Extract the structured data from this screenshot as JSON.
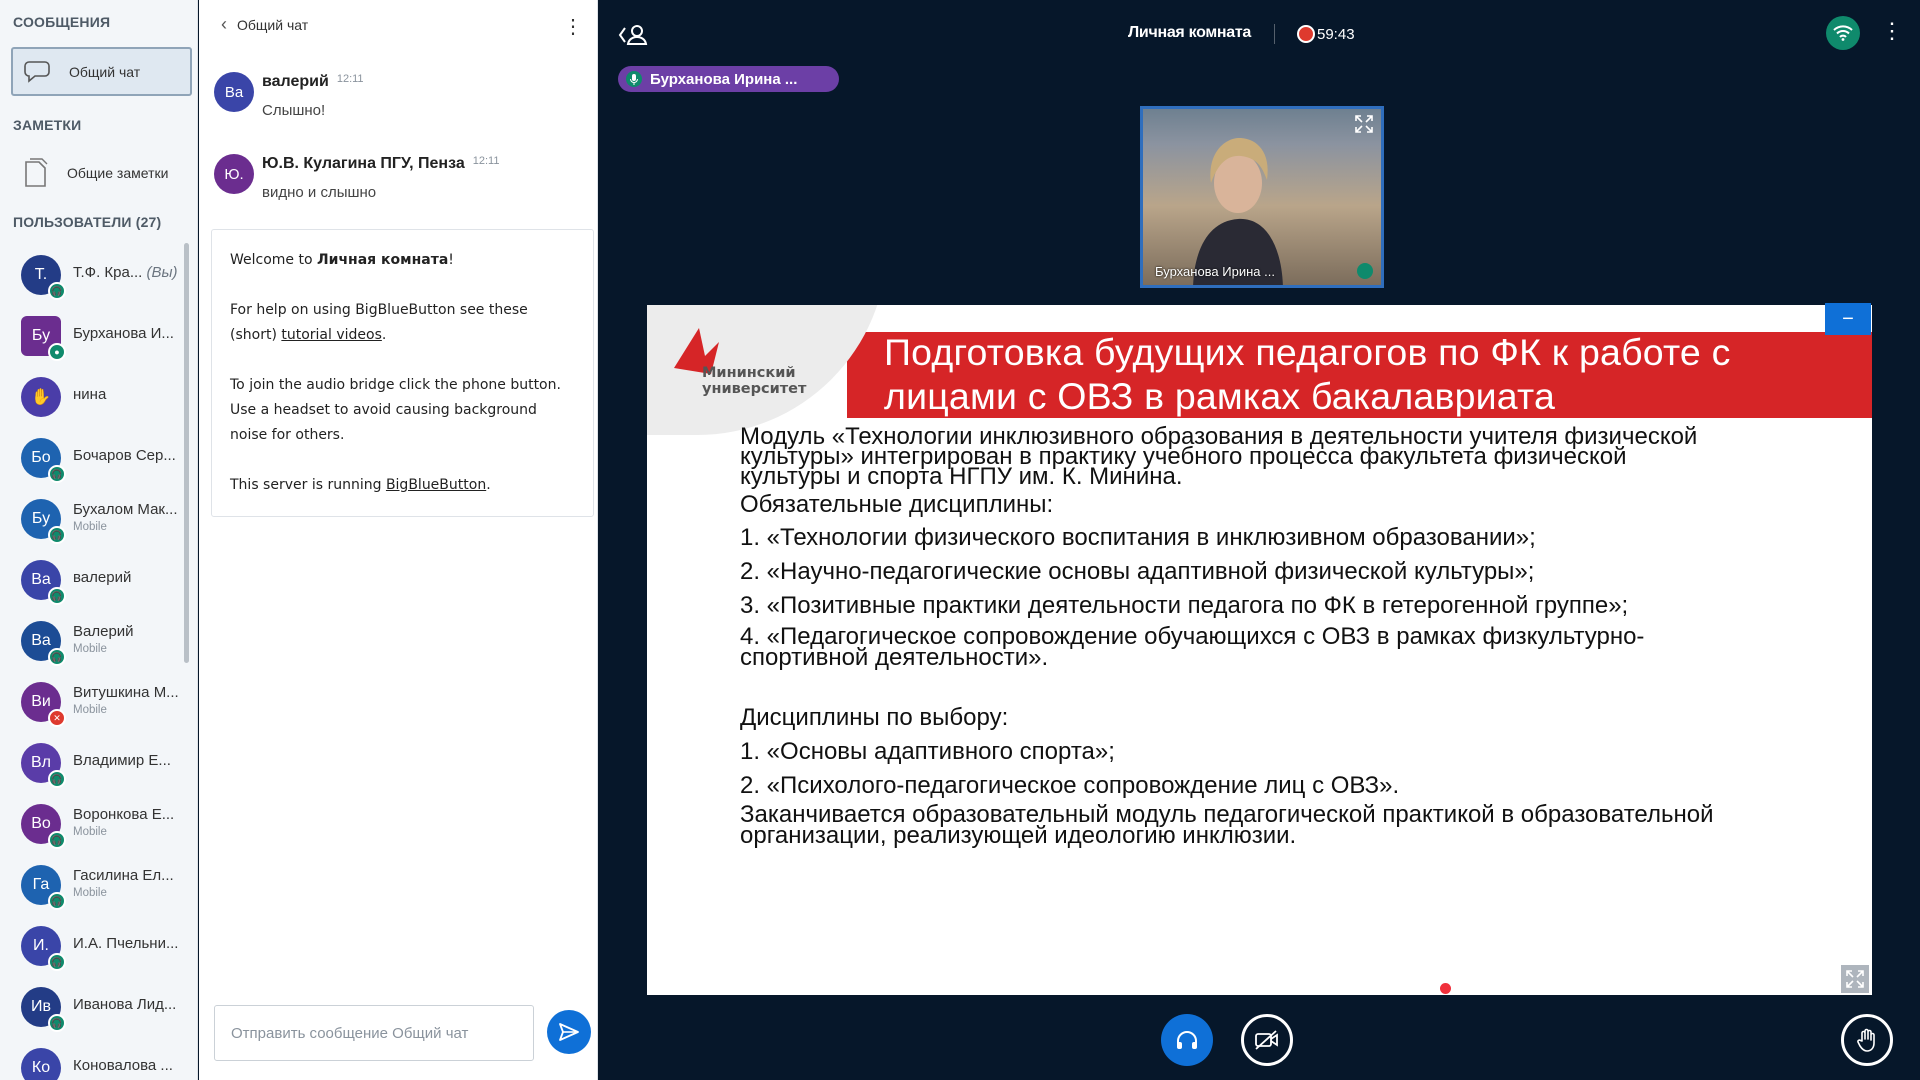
{
  "sidebar": {
    "messages_title": "СООБЩЕНИЯ",
    "public_chat": "Общий чат",
    "notes_title": "ЗАМЕТКИ",
    "shared_notes": "Общие заметки",
    "users_title": "ПОЛЬЗОВАТЕЛИ (27)"
  },
  "users": [
    {
      "initials": "Т.",
      "name": "Т.Ф. Кра...",
      "you": "(Вы)",
      "sub": "",
      "color": "#233c86",
      "badge": "headset"
    },
    {
      "initials": "Бу",
      "name": "Бурханова И...",
      "sub": "",
      "color": "#6b2d8f",
      "badge": "mic"
    },
    {
      "initials": "",
      "name": "нина",
      "sub": "",
      "color": "#4a3da8",
      "badge": "none"
    },
    {
      "initials": "Бо",
      "name": "Бочаров Сер...",
      "sub": "",
      "color": "#1e63b0",
      "badge": "headset"
    },
    {
      "initials": "Бу",
      "name": "Бухалом Мак...",
      "sub": "Mobile",
      "color": "#1e63b0",
      "badge": "headset"
    },
    {
      "initials": "Ва",
      "name": "валерий",
      "sub": "",
      "color": "#3a45a8",
      "badge": "headset"
    },
    {
      "initials": "Ва",
      "name": "Валерий",
      "sub": "Mobile",
      "color": "#1c4c95",
      "badge": "headset"
    },
    {
      "initials": "Ви",
      "name": "Витушкина М...",
      "sub": "Mobile",
      "color": "#6b2d8f",
      "badge": "muted"
    },
    {
      "initials": "Вл",
      "name": "Владимир Е...",
      "sub": "",
      "color": "#5a3ca8",
      "badge": "headset"
    },
    {
      "initials": "Во",
      "name": "Воронкова Е...",
      "sub": "Mobile",
      "color": "#6b2d8f",
      "badge": "headset"
    },
    {
      "initials": "Га",
      "name": "Гасилина Ел...",
      "sub": "Mobile",
      "color": "#1e63b0",
      "badge": "headset"
    },
    {
      "initials": "И.",
      "name": "И.А. Пчельни...",
      "sub": "",
      "color": "#3a45a8",
      "badge": "headset"
    },
    {
      "initials": "Ив",
      "name": "Иванова Лид...",
      "sub": "",
      "color": "#233c86",
      "badge": "headset"
    },
    {
      "initials": "Ко",
      "name": "Коновалова ...",
      "sub": "",
      "color": "#3a45a8",
      "badge": "none"
    }
  ],
  "chat": {
    "title": "Общий чат",
    "messages": [
      {
        "initials": "Ва",
        "name": "валерий",
        "time": "12:11",
        "text": "Слышно!",
        "color": "#3a45a8"
      },
      {
        "initials": "Ю.",
        "name": "Ю.В. Кулагина ПГУ, Пенза",
        "time": "12:11",
        "text": "видно и слышно",
        "color": "#6b2d8f"
      }
    ],
    "welcome": {
      "p1_prefix": "Welcome to ",
      "p1_room": "Личная комната",
      "p1_suffix": "!",
      "p2_text": "For help on using BigBlueButton see these (short) ",
      "p2_link": "tutorial videos",
      "p2_end": ".",
      "p3": "To join the audio bridge click the phone button. Use a headset to avoid causing background noise for others.",
      "p4_text": "This server is running ",
      "p4_link": "BigBlueButton",
      "p4_end": "."
    },
    "input_placeholder": "Отправить сообщение Общий чат"
  },
  "main": {
    "room_title": "Личная комната",
    "rec_time": "59:43",
    "talker": "Бурханова Ирина ...",
    "video_name": "Бурханова Ирина ..."
  },
  "slide": {
    "logo_line1": "Мининский",
    "logo_line2": "университет",
    "title_line1": "Подготовка будущих педагогов по ФК к работе с",
    "title_line2": "лицами с ОВЗ  в рамках бакалавриата",
    "para1_l1": "Модуль «Технологии инклюзивного образования в деятельности учителя физической",
    "para1_l2": "культуры» интегрирован в практику учебного процесса факультета физической",
    "para1_l3": "культуры и спорта НГПУ им. К. Минина.",
    "req_title": "Обязательные дисциплины:",
    "req1": "1. «Технологии физического воспитания в инклюзивном образовании»;",
    "req2": "2. «Научно-педагогические основы адаптивной физической культуры»;",
    "req3": "3. «Позитивные практики деятельности педагога по ФК в гетерогенной группе»;",
    "req4_l1": "4. «Педагогическое сопровождение обучающихся с ОВЗ в рамках физкультурно-",
    "req4_l2": "спортивной деятельности».",
    "opt_title": "Дисциплины по выбору:",
    "opt1": "1. «Основы адаптивного спорта»;",
    "opt2": "2. «Психолого-педагогическое сопровождение лиц с ОВЗ».",
    "end_l1": "Заканчивается образовательный модуль педагогической практикой в образовательной",
    "end_l2": "организации, реализующей идеологию инклюзии."
  }
}
